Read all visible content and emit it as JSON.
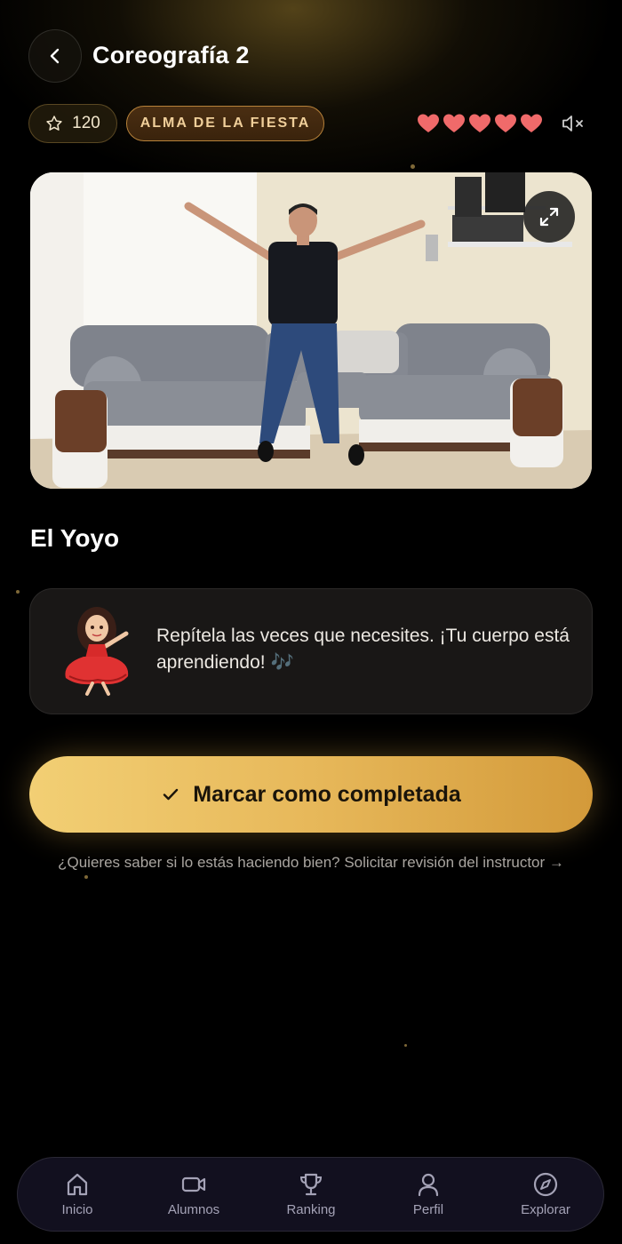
{
  "header": {
    "title": "Coreografía 2"
  },
  "stats": {
    "points": "120",
    "level_badge": "ALMA DE LA FIESTA",
    "lives": 5,
    "heart_color": "#f06a6a",
    "accent": "#e7b85a"
  },
  "lesson": {
    "title": "El Yoyo"
  },
  "tip": {
    "text": "Repítela las veces que necesites. ¡Tu cuerpo está aprendiendo! 🎶"
  },
  "actions": {
    "complete_label": "Marcar como completada",
    "review_link": "¿Quieres saber si lo estás haciendo bien? Solicitar revisión del instructor →"
  },
  "nav": {
    "items": [
      {
        "label": "Inicio",
        "icon": "home-icon"
      },
      {
        "label": "Alumnos",
        "icon": "video-icon"
      },
      {
        "label": "Ranking",
        "icon": "trophy-icon"
      },
      {
        "label": "Perfil",
        "icon": "user-icon"
      },
      {
        "label": "Explorar",
        "icon": "compass-icon"
      }
    ]
  }
}
